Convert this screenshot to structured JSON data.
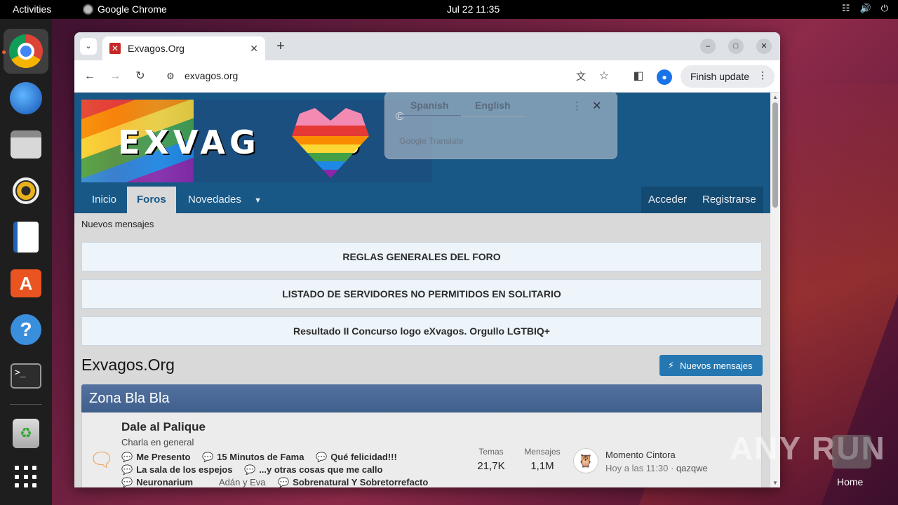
{
  "topbar": {
    "activities": "Activities",
    "app_name": "Google Chrome",
    "clock": "Jul 22  11:35"
  },
  "dock": {
    "items": [
      "chrome-icon",
      "thunderbird-icon",
      "files-icon",
      "rhythmbox-icon",
      "writer-icon",
      "app-center-icon",
      "help-icon",
      "terminal-icon",
      "trash-icon",
      "show-apps-icon"
    ]
  },
  "browser": {
    "tab_title": "Exvagos.Org",
    "url": "exvagos.org",
    "finish_update": "Finish update"
  },
  "translate": {
    "lang_from": "Spanish",
    "lang_to": "English",
    "brand": "Google Translate"
  },
  "site": {
    "nav": {
      "home": "Inicio",
      "forums": "Foros",
      "news": "Novedades",
      "login": "Acceder",
      "register": "Registrarse"
    },
    "subnav": "Nuevos mensajes",
    "notices": [
      "REGLAS GENERALES DEL FORO",
      "LISTADO DE SERVIDORES NO PERMITIDOS EN SOLITARIO",
      "Resultado II Concurso logo eXvagos. Orgullo LGTBIQ+"
    ],
    "page_title": "Exvagos.Org",
    "new_posts_btn": "Nuevos mensajes",
    "category": "Zona Bla Bla",
    "node": {
      "title": "Dale al Palique",
      "desc": "Charla en general",
      "subforums": [
        "Me Presento",
        "15 Minutos de Fama",
        "Qué felicidad!!!",
        "La sala de los espejos",
        "...y otras cosas que me callo",
        "Neuronarium",
        "Adán y Eva",
        "Sobrenatural Y Sobretorrefacto"
      ],
      "threads_label": "Temas",
      "threads_value": "21,7K",
      "posts_label": "Mensajes",
      "posts_value": "1,1M",
      "last_title": "Momento Cintora",
      "last_time": "Hoy a las 11:30",
      "last_user": "qazqwe"
    }
  },
  "watermark": {
    "text": "ANY RUN",
    "home": "Home"
  }
}
